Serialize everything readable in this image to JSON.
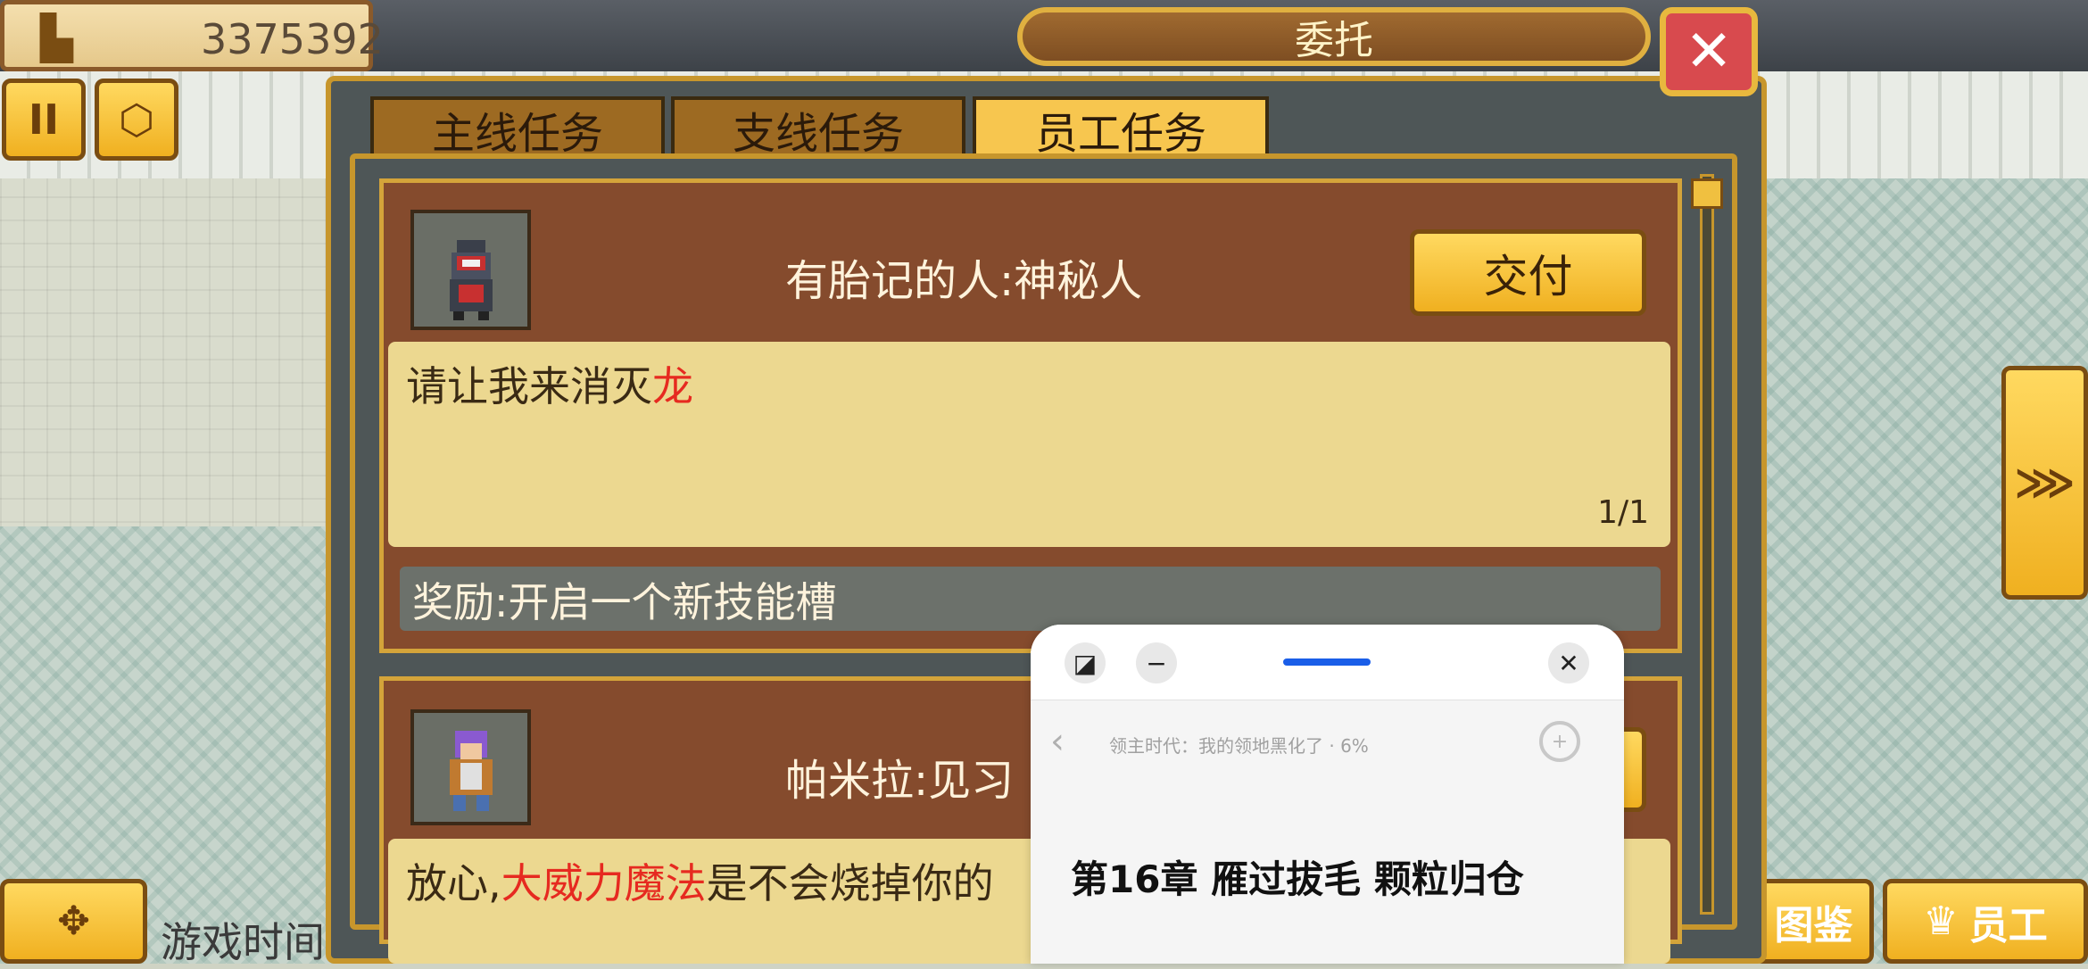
{
  "hud": {
    "gold_amount": "3375392",
    "pause_label": "II",
    "right_arrow_label": "⋙",
    "bottom_left_label": "游戏时间",
    "bottom_right_btn1": "图鉴",
    "bottom_right_btn2": "员工"
  },
  "modal": {
    "title": "委托",
    "close_label": "✕",
    "tabs": [
      {
        "label": "主线任务",
        "active": false
      },
      {
        "label": "支线任务",
        "active": false
      },
      {
        "label": "员工任务",
        "active": true
      }
    ]
  },
  "tasks": [
    {
      "title": "有胎记的人:神秘人",
      "button": "交付",
      "desc_prefix": "请让我来消灭",
      "desc_highlight": "龙",
      "desc_suffix": "",
      "progress": "1/1",
      "reward": "奖励:开启一个新技能槽"
    },
    {
      "title": "帕米拉:见习",
      "desc_prefix": "放心,",
      "desc_highlight": "大威力魔法",
      "desc_suffix": "是不会烧掉你的"
    }
  ],
  "popup": {
    "book_title": "领主时代：我的领地黑化了 · 6%",
    "chapter_title": "第16章 雁过拔毛 颗粒归仓"
  },
  "colors": {
    "card_bg": "#854b2d",
    "frame_gold": "#c7962c",
    "tab_active": "#f7c64f",
    "highlight_red": "#e62a20",
    "popup_accent": "#1a5ee8"
  }
}
